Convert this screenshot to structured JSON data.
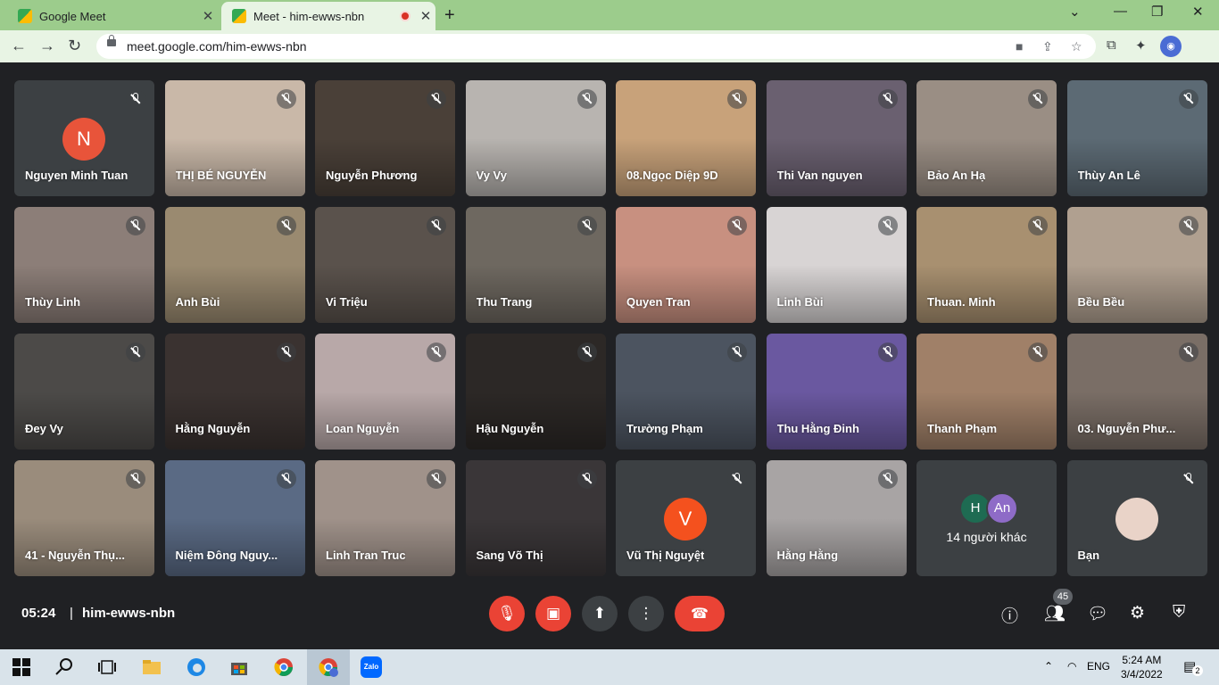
{
  "browser": {
    "tabs": [
      {
        "title": "Google Meet",
        "active": false
      },
      {
        "title": "Meet - him-ewws-nbn",
        "active": true,
        "recording": true
      }
    ],
    "url": "meet.google.com/him-ewws-nbn"
  },
  "tiles": [
    {
      "name": "Nguyen Minh Tuan",
      "avatar": "N",
      "avatar_color": "#e8543a",
      "bg": "#3c4043"
    },
    {
      "name": "THỊ BÉ NGUYỄN",
      "bg": "#c9b8a8"
    },
    {
      "name": "Nguyễn Phương",
      "bg": "#4a4038"
    },
    {
      "name": "Vy Vy",
      "bg": "#b8b4b0"
    },
    {
      "name": "08.Ngọc Diệp 9D",
      "bg": "#c8a27a"
    },
    {
      "name": "Thi Van nguyen",
      "bg": "#6a6070"
    },
    {
      "name": "Bảo An Hạ",
      "bg": "#9a8e84"
    },
    {
      "name": "Thùy An Lê",
      "bg": "#5c6a74"
    },
    {
      "name": "Thùy Linh",
      "bg": "#8c7e78"
    },
    {
      "name": "Anh Bùi",
      "bg": "#9a8a70"
    },
    {
      "name": "Vi Triệu",
      "bg": "#5a524c"
    },
    {
      "name": "Thu Trang",
      "bg": "#6e6860"
    },
    {
      "name": "Quyen Tran",
      "bg": "#c89080"
    },
    {
      "name": "Linh Bùi",
      "bg": "#d8d4d4"
    },
    {
      "name": "Thuan. Minh",
      "bg": "#a89070"
    },
    {
      "name": "Bều Bều",
      "bg": "#b0a090"
    },
    {
      "name": "Đey Vy",
      "bg": "#4c4a48"
    },
    {
      "name": "Hằng Nguyễn",
      "bg": "#3a3230"
    },
    {
      "name": "Loan Nguyễn",
      "bg": "#b8a8a8"
    },
    {
      "name": "Hậu Nguyễn",
      "bg": "#2c2826"
    },
    {
      "name": "Trường Phạm",
      "bg": "#4c5460"
    },
    {
      "name": "Thu Hằng Đinh",
      "bg": "#6a58a0"
    },
    {
      "name": "Thanh Phạm",
      "bg": "#a08068"
    },
    {
      "name": "03. Nguyễn Phư...",
      "bg": "#7a6e66"
    },
    {
      "name": "41 - Nguyễn Thụ...",
      "bg": "#9a8c7c"
    },
    {
      "name": "Niệm Đông Nguy...",
      "bg": "#5a6a84"
    },
    {
      "name": "Linh Tran Truc",
      "bg": "#a0928a"
    },
    {
      "name": "Sang Võ Thị",
      "bg": "#3a3638"
    },
    {
      "name": "Vũ Thị Nguyệt",
      "avatar": "V",
      "avatar_color": "#f4511e",
      "bg": "#3c4043"
    },
    {
      "name": "Hằng Hằng",
      "bg": "#a8a4a4"
    },
    {
      "name": "Bạn",
      "bg": "#3c4043",
      "self": true
    }
  ],
  "others": {
    "avatars": [
      "H",
      "An"
    ],
    "avatar_colors": [
      "#1e6b52",
      "#8e6bc7"
    ],
    "count_label": "14 người khác"
  },
  "bottom_bar": {
    "time": "05:24",
    "separator": "|",
    "meeting_code": "him-ewws-nbn",
    "participants_count": "45"
  },
  "taskbar": {
    "language": "ENG",
    "time": "5:24 AM",
    "date": "3/4/2022",
    "notifications": "2",
    "zalo_label": "Zalo"
  }
}
